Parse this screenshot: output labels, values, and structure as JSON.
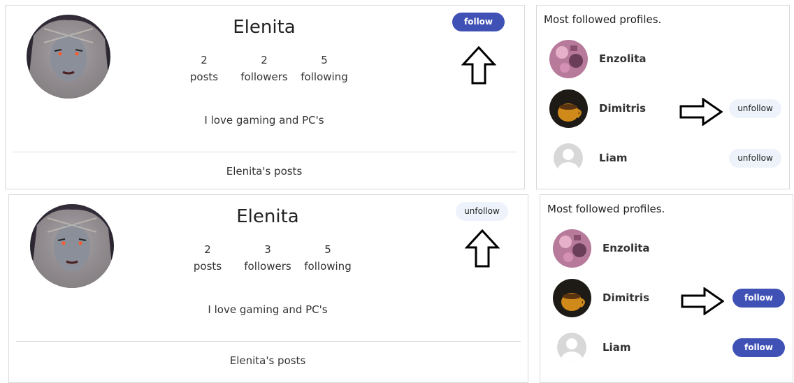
{
  "before": {
    "profile": {
      "name": "Elenita",
      "stats": [
        {
          "value": "2",
          "label": "posts"
        },
        {
          "value": "2",
          "label": "followers"
        },
        {
          "value": "5",
          "label": "following"
        }
      ],
      "bio": "I love gaming and PC's",
      "posts_title": "Elenita's posts",
      "action_label": "follow"
    },
    "sidebar": {
      "title": "Most followed profiles.",
      "profiles": [
        {
          "name": "Enzolita",
          "action": ""
        },
        {
          "name": "Dimitris",
          "action": "unfollow"
        },
        {
          "name": "Liam",
          "action": "unfollow"
        }
      ]
    }
  },
  "after": {
    "profile": {
      "name": "Elenita",
      "stats": [
        {
          "value": "2",
          "label": "posts"
        },
        {
          "value": "3",
          "label": "followers"
        },
        {
          "value": "5",
          "label": "following"
        }
      ],
      "bio": "I love gaming and PC's",
      "posts_title": "Elenita's posts",
      "action_label": "unfollow"
    },
    "sidebar": {
      "title": "Most followed profiles.",
      "profiles": [
        {
          "name": "Enzolita",
          "action": ""
        },
        {
          "name": "Dimitris",
          "action": "follow"
        },
        {
          "name": "Liam",
          "action": "follow"
        }
      ]
    }
  },
  "colors": {
    "follow_button": "#3f51b5",
    "unfollow_button": "#eef3fb",
    "card_border": "#d9d9d9"
  },
  "icons": {
    "up_arrow": "up-arrow-outline-icon",
    "right_arrow": "right-arrow-outline-icon"
  }
}
